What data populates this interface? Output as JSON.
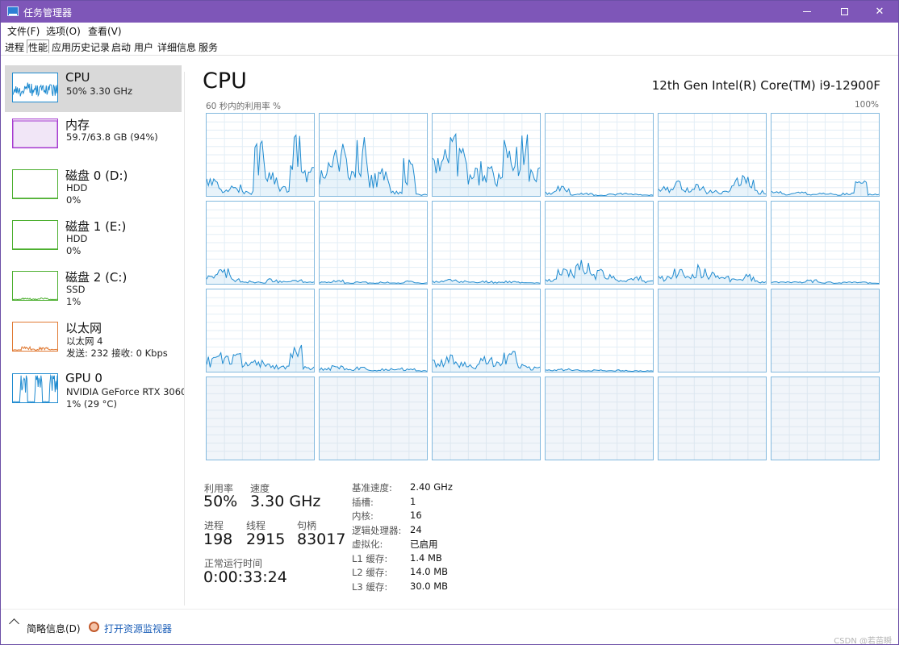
{
  "window": {
    "title": "任务管理器"
  },
  "menu": [
    "文件(F)",
    "选项(O)",
    "查看(V)"
  ],
  "tabs": [
    {
      "label": "进程",
      "active": false
    },
    {
      "label": "性能",
      "active": true
    },
    {
      "label": "应用历史记录",
      "active": false
    },
    {
      "label": "启动",
      "active": false
    },
    {
      "label": "用户",
      "active": false
    },
    {
      "label": "详细信息",
      "active": false
    },
    {
      "label": "服务",
      "active": false
    }
  ],
  "sidebar": {
    "items": [
      {
        "name": "CPU",
        "line1": "50%  3.30 GHz",
        "line2": "",
        "color": "#1f8bd0",
        "selected": true
      },
      {
        "name": "内存",
        "line1": "59.7/63.8 GB (94%)",
        "line2": "",
        "color": "#a63bd0",
        "selected": false
      },
      {
        "name": "磁盘 0 (D:)",
        "line1": "HDD",
        "line2": "0%",
        "color": "#4caf2f",
        "selected": false
      },
      {
        "name": "磁盘 1 (E:)",
        "line1": "HDD",
        "line2": "0%",
        "color": "#4caf2f",
        "selected": false
      },
      {
        "name": "磁盘 2 (C:)",
        "line1": "SSD",
        "line2": "1%",
        "color": "#4caf2f",
        "selected": false
      },
      {
        "name": "以太网",
        "line1": "以太网 4",
        "line2": "发送: 232  接收: 0 Kbps",
        "color": "#e07a34",
        "selected": false
      },
      {
        "name": "GPU 0",
        "line1": "NVIDIA GeForce RTX 3060",
        "line2": "1% (29 °C)",
        "color": "#1f8bd0",
        "selected": false
      }
    ]
  },
  "main": {
    "title": "CPU",
    "model": "12th Gen Intel(R) Core(TM) i9-12900F",
    "graph_caption": "60 秒内的利用率 %",
    "graph_max": "100%",
    "accent": "#1f8bd0",
    "cores": [
      {
        "active": true,
        "peaks": [
          0.18,
          0.08,
          0.12,
          0.05,
          0.55,
          0.25,
          0.1,
          0.62,
          0.3
        ]
      },
      {
        "active": true,
        "peaks": [
          0.35,
          0.55,
          0.45,
          0.6,
          0.25,
          0.3,
          0.05,
          0.38,
          0.02
        ]
      },
      {
        "active": true,
        "peaks": [
          0.4,
          0.62,
          0.5,
          0.3,
          0.35,
          0.25,
          0.55,
          0.65,
          0.3
        ]
      },
      {
        "active": true,
        "peaks": [
          0.05,
          0.1,
          0.02,
          0.03,
          0.01,
          0.02,
          0.03,
          0.02,
          0.01
        ]
      },
      {
        "active": true,
        "peaks": [
          0.1,
          0.15,
          0.08,
          0.12,
          0.06,
          0.05,
          0.18,
          0.2,
          0.06
        ]
      },
      {
        "active": true,
        "peaks": [
          0.05,
          0.03,
          0.04,
          0.02,
          0.03,
          0.02,
          0.03,
          0.15,
          0.02
        ]
      },
      {
        "active": true,
        "peaks": [
          0.1,
          0.15,
          0.05,
          0.03,
          0.02,
          0.05,
          0.03,
          0.04,
          0.02
        ]
      },
      {
        "active": true,
        "peaks": [
          0.02,
          0.04,
          0.01,
          0.02,
          0.01,
          0.02,
          0.01,
          0.03,
          0.01
        ]
      },
      {
        "active": true,
        "peaks": [
          0.03,
          0.05,
          0.04,
          0.02,
          0.03,
          0.02,
          0.03,
          0.02,
          0.01
        ]
      },
      {
        "active": true,
        "peaks": [
          0.05,
          0.15,
          0.2,
          0.25,
          0.15,
          0.1,
          0.05,
          0.08,
          0.03
        ]
      },
      {
        "active": true,
        "peaks": [
          0.08,
          0.15,
          0.1,
          0.2,
          0.12,
          0.08,
          0.05,
          0.1,
          0.03
        ]
      },
      {
        "active": true,
        "peaks": [
          0.02,
          0.03,
          0.02,
          0.04,
          0.02,
          0.01,
          0.02,
          0.02,
          0.01
        ]
      },
      {
        "active": true,
        "peaks": [
          0.15,
          0.2,
          0.18,
          0.1,
          0.12,
          0.08,
          0.06,
          0.3,
          0.05
        ]
      },
      {
        "active": true,
        "peaks": [
          0.04,
          0.06,
          0.03,
          0.05,
          0.02,
          0.03,
          0.04,
          0.03,
          0.01
        ]
      },
      {
        "active": true,
        "peaks": [
          0.12,
          0.18,
          0.1,
          0.08,
          0.15,
          0.1,
          0.2,
          0.12,
          0.05
        ]
      },
      {
        "active": true,
        "peaks": [
          0.02,
          0.03,
          0.02,
          0.01,
          0.02,
          0.01,
          0.02,
          0.01,
          0.01
        ]
      },
      {
        "active": false,
        "peaks": []
      },
      {
        "active": false,
        "peaks": []
      },
      {
        "active": false,
        "peaks": []
      },
      {
        "active": false,
        "peaks": []
      },
      {
        "active": false,
        "peaks": []
      },
      {
        "active": false,
        "peaks": []
      },
      {
        "active": false,
        "peaks": []
      },
      {
        "active": false,
        "peaks": []
      }
    ],
    "stats": {
      "util_label": "利用率",
      "util_value": "50%",
      "speed_label": "速度",
      "speed_value": "3.30 GHz",
      "proc_label": "进程",
      "proc_value": "198",
      "thread_label": "线程",
      "thread_value": "2915",
      "handle_label": "句柄",
      "handle_value": "83017",
      "uptime_label": "正常运行时间",
      "uptime_value": "0:00:33:24"
    },
    "info": [
      {
        "key": "基准速度:",
        "value": "2.40 GHz"
      },
      {
        "key": "插槽:",
        "value": "1"
      },
      {
        "key": "内核:",
        "value": "16"
      },
      {
        "key": "逻辑处理器:",
        "value": "24"
      },
      {
        "key": "虚拟化:",
        "value": "已启用"
      },
      {
        "key": "L1 缓存:",
        "value": "1.4 MB"
      },
      {
        "key": "L2 缓存:",
        "value": "14.0 MB"
      },
      {
        "key": "L3 缓存:",
        "value": "30.0 MB"
      }
    ]
  },
  "footer": {
    "fewer_details": "简略信息(D)",
    "resmon": "打开资源监视器",
    "watermark": "CSDN @若苗瞬"
  }
}
